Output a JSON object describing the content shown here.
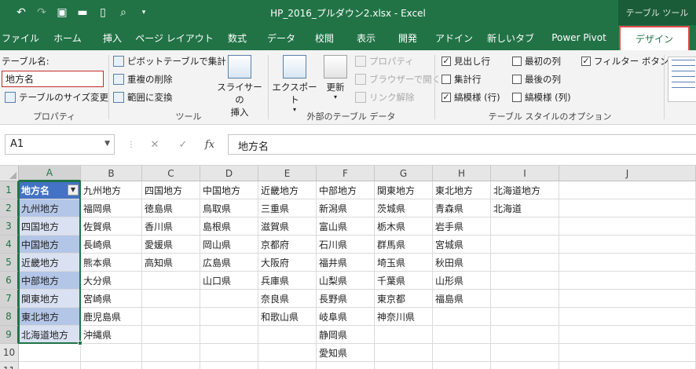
{
  "window": {
    "title": "HP_2016_プルダウン2.xlsx  -  Excel",
    "contextual_title": "テーブル ツール"
  },
  "qat": {
    "undo_icon": "undo-icon",
    "redo_icon": "redo-icon",
    "save_icon": "save-icon",
    "open_icon": "open-folder-icon",
    "new_icon": "new-document-icon",
    "preview_icon": "print-preview-icon",
    "customize_icon": "customize-qat-icon"
  },
  "tabs": [
    "ファイル",
    "ホーム",
    "挿入",
    "ページ レイアウト",
    "数式",
    "データ",
    "校閲",
    "表示",
    "開発",
    "アドイン",
    "新しいタブ",
    "Power Pivot",
    "デザイン"
  ],
  "active_tab": "デザイン",
  "ribbon": {
    "properties": {
      "table_name_label": "テーブル名:",
      "table_name_value": "地方名",
      "resize_label": "テーブルのサイズ変更",
      "group_label": "プロパティ"
    },
    "tools": {
      "pivot_label": "ピボットテーブルで集計",
      "dedupe_label": "重複の削除",
      "convert_label": "範囲に変換",
      "slicer_label_1": "スライサーの",
      "slicer_label_2": "挿入",
      "group_label": "ツール"
    },
    "external": {
      "export_label": "エクスポート",
      "refresh_label": "更新",
      "properties_label": "プロパティ",
      "browser_label": "ブラウザーで開く",
      "unlink_label": "リンク解除",
      "group_label": "外部のテーブル データ"
    },
    "style_options": {
      "header_row": "見出し行",
      "total_row": "集計行",
      "banded_rows": "縞模様 (行)",
      "first_column": "最初の列",
      "last_column": "最後の列",
      "banded_columns": "縞模様 (列)",
      "filter_button": "フィルター ボタン",
      "group_label": "テーブル スタイルのオプション",
      "check_mark": "✓"
    }
  },
  "formula_bar": {
    "name_box": "A1",
    "cancel": "✕",
    "enter": "✓",
    "fx": "fx",
    "formula": "地方名"
  },
  "columns": [
    "A",
    "B",
    "C",
    "D",
    "E",
    "F",
    "G",
    "H",
    "I",
    "J"
  ],
  "rows": [
    "1",
    "2",
    "3",
    "4",
    "5",
    "6",
    "7",
    "8",
    "9",
    "10",
    "11"
  ],
  "sheet": {
    "A": [
      "地方名",
      "九州地方",
      "四国地方",
      "中国地方",
      "近畿地方",
      "中部地方",
      "関東地方",
      "東北地方",
      "北海道地方",
      "",
      ""
    ],
    "B": [
      "九州地方",
      "福岡県",
      "佐賀県",
      "長崎県",
      "熊本県",
      "大分県",
      "宮崎県",
      "鹿児島県",
      "沖縄県",
      "",
      ""
    ],
    "C": [
      "四国地方",
      "徳島県",
      "香川県",
      "愛媛県",
      "高知県",
      "",
      "",
      "",
      "",
      "",
      ""
    ],
    "D": [
      "中国地方",
      "鳥取県",
      "島根県",
      "岡山県",
      "広島県",
      "山口県",
      "",
      "",
      "",
      "",
      ""
    ],
    "E": [
      "近畿地方",
      "三重県",
      "滋賀県",
      "京都府",
      "大阪府",
      "兵庫県",
      "奈良県",
      "和歌山県",
      "",
      "",
      ""
    ],
    "F": [
      "中部地方",
      "新潟県",
      "富山県",
      "石川県",
      "福井県",
      "山梨県",
      "長野県",
      "岐阜県",
      "静岡県",
      "愛知県",
      ""
    ],
    "G": [
      "関東地方",
      "茨城県",
      "栃木県",
      "群馬県",
      "埼玉県",
      "千葉県",
      "東京都",
      "神奈川県",
      "",
      "",
      ""
    ],
    "H": [
      "東北地方",
      "青森県",
      "岩手県",
      "宮城県",
      "秋田県",
      "山形県",
      "福島県",
      "",
      "",
      "",
      ""
    ],
    "I": [
      "北海道地方",
      "北海道",
      "",
      "",
      "",
      "",
      "",
      "",
      "",
      "",
      ""
    ],
    "J": [
      "",
      "",
      "",
      "",
      "",
      "",
      "",
      "",
      "",
      "",
      ""
    ]
  },
  "filter_icon": "dropdown-filter-icon",
  "filter_glyph": "▼"
}
